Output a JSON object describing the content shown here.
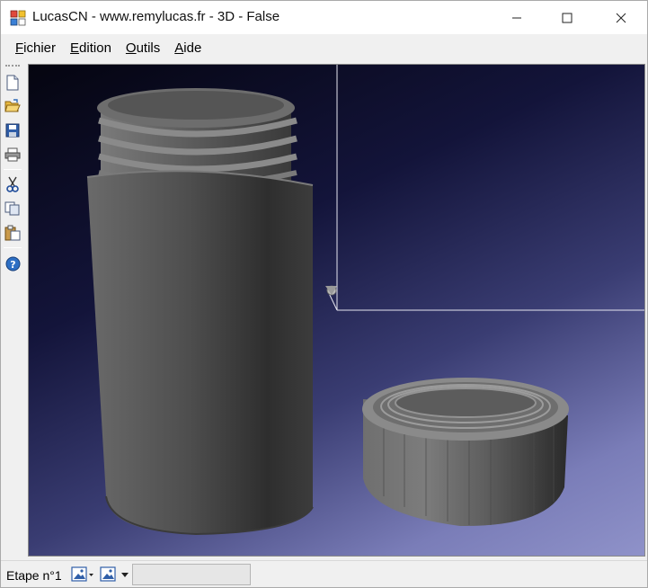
{
  "window": {
    "title": "LucasCN - www.remylucas.fr - 3D - False",
    "icons": {
      "app": "lucascn-app-icon",
      "minimize": "minimize-icon",
      "maximize": "maximize-icon",
      "close": "close-icon"
    }
  },
  "menu": {
    "items": [
      {
        "mnemonic": "F",
        "rest": "ichier"
      },
      {
        "mnemonic": "E",
        "rest": "dition"
      },
      {
        "mnemonic": "O",
        "rest": "utils"
      },
      {
        "mnemonic": "A",
        "rest": "ide"
      }
    ]
  },
  "toolbar": {
    "buttons": [
      "new-file-icon",
      "open-folder-icon",
      "save-icon",
      "print-icon",
      "cut-icon",
      "copy-icon",
      "paste-icon",
      "help-icon"
    ]
  },
  "viewport": {
    "background_top": "#050510",
    "background_bottom": "#8f92c9",
    "objects": [
      "threaded-jar",
      "screw-cap"
    ],
    "axis_color": "#e6e6f0"
  },
  "statusbar": {
    "step_label": "Etape n°1",
    "dropdown_icons": [
      "image-dropdown-icon",
      "image-dropdown-icon"
    ],
    "field_value": ""
  }
}
